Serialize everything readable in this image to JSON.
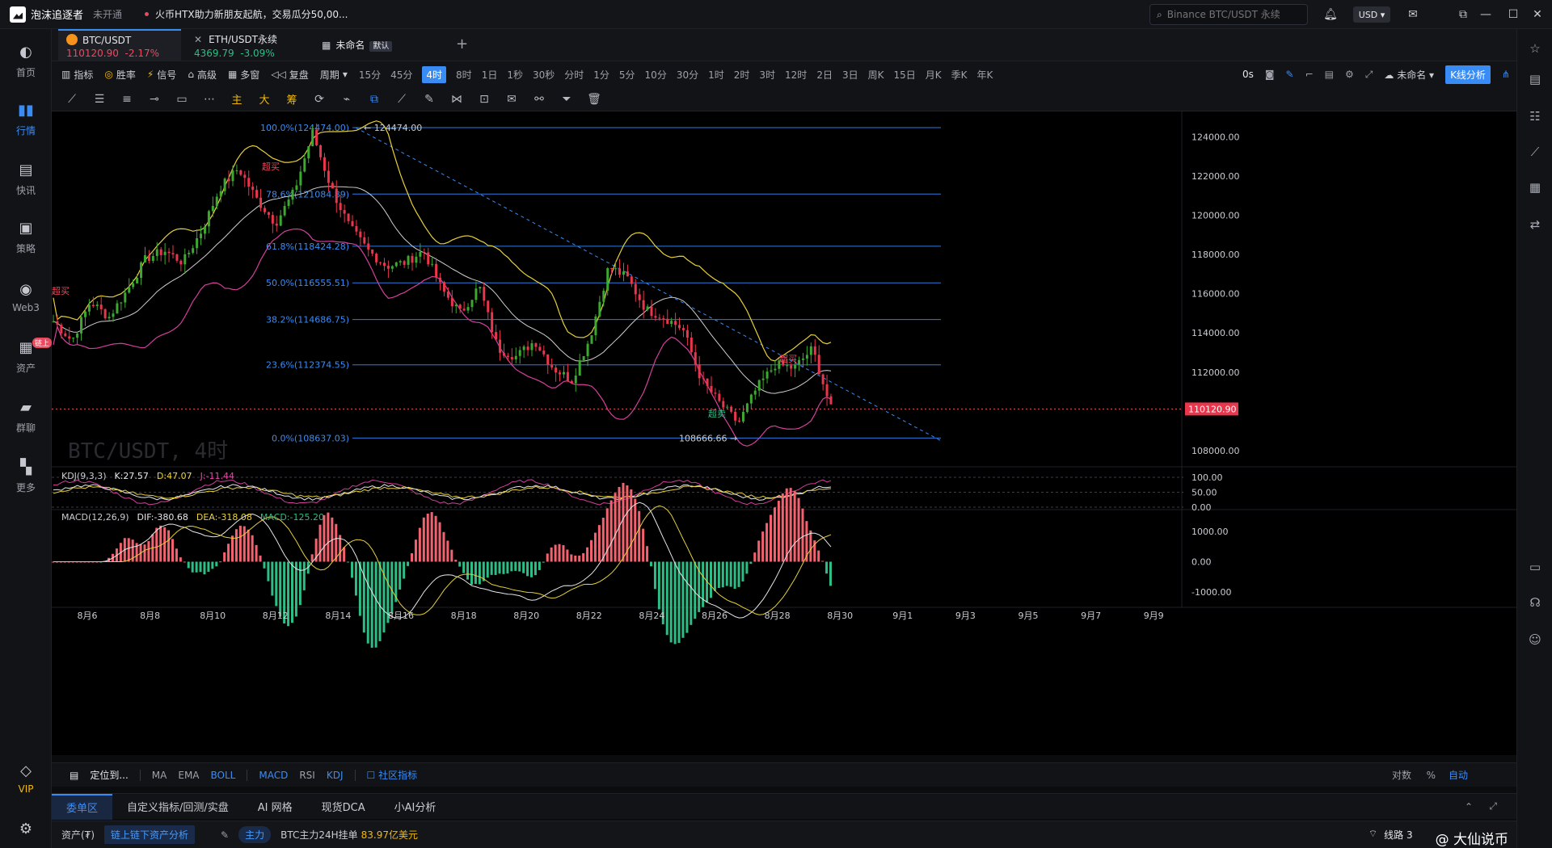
{
  "titlebar": {
    "app_name": "泡沫追逐者",
    "status": "未开通",
    "news": "火币HTX助力新朋友起航，交易瓜分50,00...",
    "search_placeholder": "Binance BTC/USDT 永续",
    "currency": "USD"
  },
  "leftnav": {
    "items": [
      {
        "label": "首页",
        "icon": "home-icon"
      },
      {
        "label": "行情",
        "icon": "market-icon"
      },
      {
        "label": "快讯",
        "icon": "news-icon"
      },
      {
        "label": "策略",
        "icon": "strategy-icon"
      },
      {
        "label": "Web3",
        "icon": "web3-icon"
      },
      {
        "label": "资产",
        "icon": "wallet-icon"
      },
      {
        "label": "群聊",
        "icon": "chat-icon"
      },
      {
        "label": "更多",
        "icon": "more-icon"
      }
    ],
    "asset_badge": "链上",
    "vip_label": "VIP"
  },
  "tabs": [
    {
      "name": "BTC/USDT",
      "price": "110120.90",
      "change": "-2.17%"
    },
    {
      "name": "ETH/USDT永续",
      "price": "4369.79",
      "change": "-3.09%"
    }
  ],
  "layout_tab": {
    "name": "未命名",
    "tag": "默认"
  },
  "toolbar": {
    "indicator": "指标",
    "winrate": "胜率",
    "signal": "信号",
    "advanced": "高级",
    "multi": "多窗",
    "replay": "复盘",
    "period": "周期",
    "periods": [
      "15分",
      "45分",
      "4时",
      "8时",
      "1日",
      "1秒",
      "30秒",
      "分时",
      "1分",
      "5分",
      "10分",
      "30分",
      "1时",
      "2时",
      "3时",
      "12时",
      "2日",
      "3日",
      "周K",
      "15日",
      "月K",
      "季K",
      "年K"
    ],
    "active_period": "4时",
    "countdown": "0s",
    "layout_name": "未命名",
    "kline_analysis": "K线分析"
  },
  "drawtools": {
    "main": "主",
    "big": "大",
    "chip": "筹"
  },
  "chart": {
    "watermark": "BTC/USDT, 4时",
    "current_price": "110120.90",
    "fib_levels": [
      {
        "label": "100.0%(124474.00)",
        "value": 124474.0
      },
      {
        "label": "78.6%(121084.89)",
        "value": 121084.89
      },
      {
        "label": "61.8%(118424.28)",
        "value": 118424.28
      },
      {
        "label": "50.0%(116555.51)",
        "value": 116555.51
      },
      {
        "label": "38.2%(114686.75)",
        "value": 114686.75
      },
      {
        "label": "23.6%(112374.55)",
        "value": 112374.55
      },
      {
        "label": "0.0%(108637.03)",
        "value": 108637.03
      }
    ],
    "high_label": "124474.00",
    "low_label": "108666.66",
    "overbought": "超买",
    "oversold": "超卖",
    "price_axis": [
      "124000.00",
      "122000.00",
      "120000.00",
      "118000.00",
      "116000.00",
      "114000.00",
      "112000.00",
      "108000.00"
    ],
    "date_axis": [
      "8月6",
      "8月8",
      "8月10",
      "8月12",
      "8月14",
      "8月16",
      "8月18",
      "8月20",
      "8月22",
      "8月24",
      "8月26",
      "8月28",
      "8月30",
      "9月1",
      "9月3",
      "9月5",
      "9月7",
      "9月9"
    ],
    "kdj": {
      "title": "KDJ(9,3,3)",
      "k": "K:27.57",
      "d": "D:47.07",
      "j": "J:-11.44",
      "axis": [
        "100.00",
        "50.00",
        "0.00"
      ]
    },
    "macd": {
      "title": "MACD(12,26,9)",
      "dif": "DIF:-380.68",
      "dea": "DEA:-318.08",
      "macd": "MACD:-125.20",
      "axis": [
        "1000.00",
        "0.00",
        "-1000.00"
      ]
    }
  },
  "chart_data": {
    "type": "candlestick",
    "title": "BTC/USDT, 4时",
    "ylim": [
      107500,
      125300
    ],
    "x": [
      "8月6",
      "8月8",
      "8月10",
      "8月12",
      "8月14",
      "8月16",
      "8月18",
      "8月20",
      "8月22",
      "8月24",
      "8月26",
      "8月28",
      "8月30"
    ],
    "close_approx": [
      114800,
      116800,
      118200,
      121800,
      122000,
      118000,
      117000,
      113200,
      112500,
      115200,
      111600,
      112300,
      110120.9
    ],
    "current_price": 110120.9,
    "fibonacci": [
      124474.0,
      121084.89,
      118424.28,
      116555.51,
      114686.75,
      112374.55,
      108637.03
    ]
  },
  "indicator_bar": {
    "locate": "定位到...",
    "ma": "MA",
    "ema": "EMA",
    "boll": "BOLL",
    "macd": "MACD",
    "rsi": "RSI",
    "kdj": "KDJ",
    "community": "社区指标",
    "compare": "对数",
    "percent": "%",
    "auto": "自动"
  },
  "bottom_tabs": [
    "委单区",
    "自定义指标/回测/实盘",
    "AI 网格",
    "现货DCA",
    "小AI分析"
  ],
  "statusbar": {
    "assets": "资产(₮)",
    "onchain": "链上链下资产分析",
    "main_tag": "主力",
    "main_text": "BTC主力24H挂单",
    "main_amount": "83.97亿美元",
    "line": "线路 3",
    "watermark": "@ 大仙说币"
  }
}
